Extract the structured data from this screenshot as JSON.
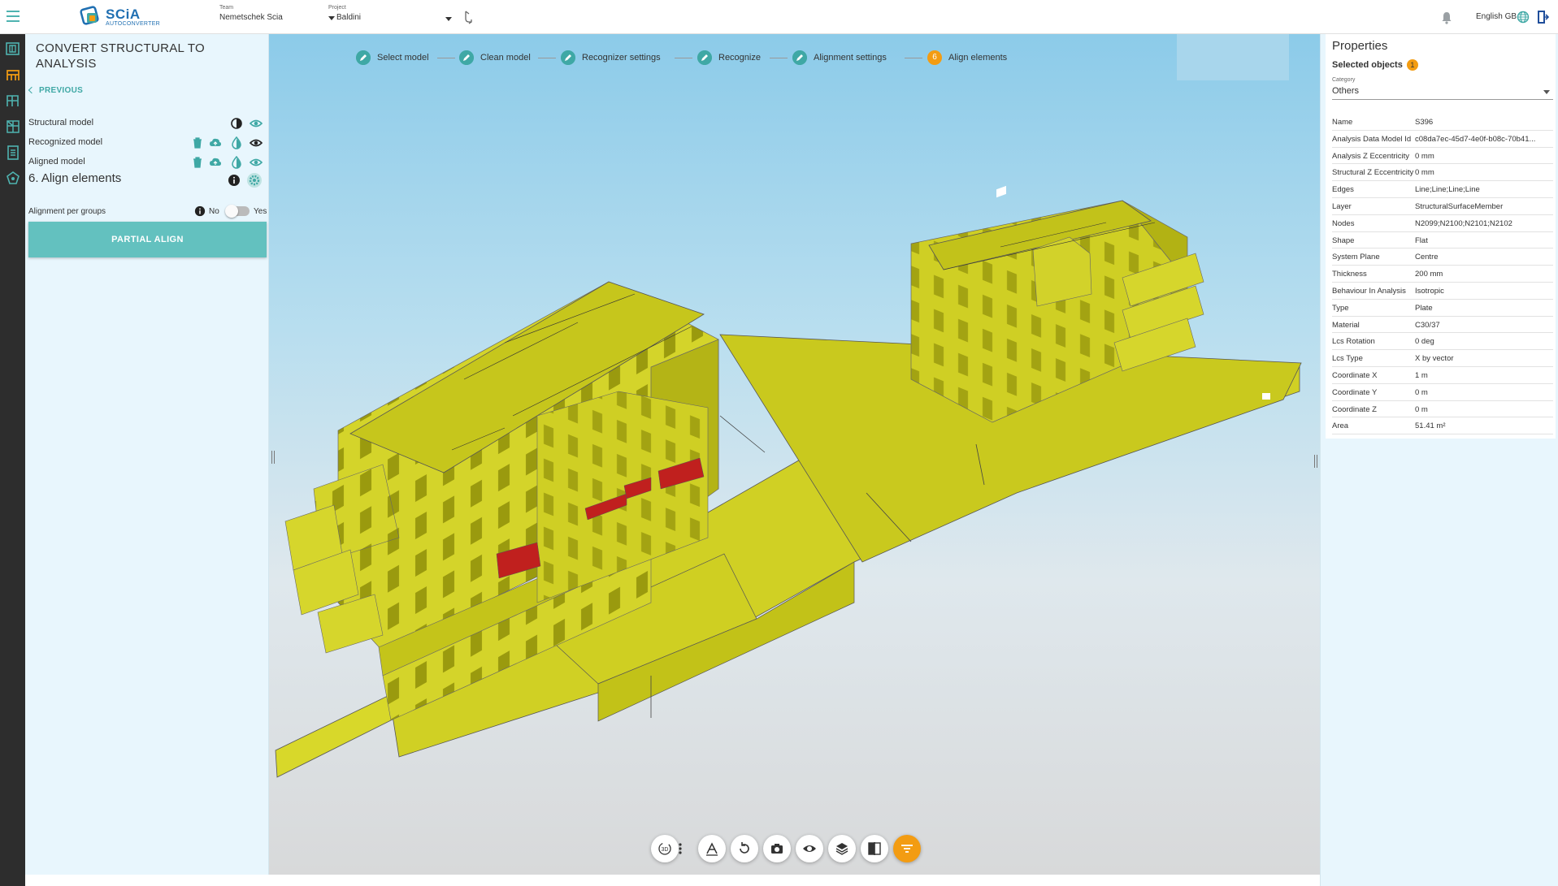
{
  "header": {
    "logo_brand": "SCiA",
    "logo_sub": "AUTOCONVERTER",
    "team_label": "Team",
    "team_value": "Nemetschek Scia",
    "project_label": "Project",
    "project_value": "Baldini",
    "language": "English GB"
  },
  "left_panel": {
    "title": "CONVERT STRUCTURAL TO ANALYSIS",
    "previous": "PREVIOUS",
    "models": [
      {
        "label": "Structural model"
      },
      {
        "label": "Recognized model"
      },
      {
        "label": "Aligned model"
      }
    ],
    "step_title": "6.  Align elements",
    "alignment_label": "Alignment per groups",
    "toggle_no": "No",
    "toggle_yes": "Yes",
    "partial_align": "PARTIAL ALIGN"
  },
  "stepper": {
    "steps": [
      {
        "label": "Select model"
      },
      {
        "label": "Clean model"
      },
      {
        "label": "Recognizer settings"
      },
      {
        "label": "Recognize"
      },
      {
        "label": "Alignment settings"
      },
      {
        "label": "Align elements",
        "number": "6"
      }
    ]
  },
  "toolbar": {
    "view_mode": "3D",
    "icons": [
      "3d-view-icon",
      "more-vert-icon",
      "measure-icon",
      "reset-view-icon",
      "camera-icon",
      "visibility-icon",
      "layers-icon",
      "compare-icon",
      "filter-icon"
    ]
  },
  "properties": {
    "title": "Properties",
    "selected_label": "Selected objects",
    "selected_count": "1",
    "category_label": "Category",
    "category_value": "Others",
    "rows": [
      {
        "k": "Name",
        "v": "S396"
      },
      {
        "k": "Analysis Data Model Id",
        "v": "c08da7ec-45d7-4e0f-b08c-70b41..."
      },
      {
        "k": "Analysis Z Eccentricity",
        "v": "0 mm"
      },
      {
        "k": "Structural Z Eccentricity",
        "v": "0 mm"
      },
      {
        "k": "Edges",
        "v": "Line;Line;Line;Line"
      },
      {
        "k": "Layer",
        "v": "StructuralSurfaceMember"
      },
      {
        "k": "Nodes",
        "v": "N2099;N2100;N2101;N2102"
      },
      {
        "k": "Shape",
        "v": "Flat"
      },
      {
        "k": "System Plane",
        "v": "Centre"
      },
      {
        "k": "Thickness",
        "v": "200 mm"
      },
      {
        "k": "Behaviour In Analysis",
        "v": "Isotropic"
      },
      {
        "k": "Type",
        "v": "Plate"
      },
      {
        "k": "Material",
        "v": "C30/37"
      },
      {
        "k": "Lcs Rotation",
        "v": "0 deg"
      },
      {
        "k": "Lcs Type",
        "v": "X by vector"
      },
      {
        "k": "Coordinate X",
        "v": "1 m"
      },
      {
        "k": "Coordinate Y",
        "v": "0 m"
      },
      {
        "k": "Coordinate Z",
        "v": "0 m"
      },
      {
        "k": "Area",
        "v": "51.41 m²"
      }
    ]
  },
  "colors": {
    "accent": "#3fa8a5",
    "orange": "#f39c12",
    "model_yellow": "#c8c81a",
    "highlight_red": "#c0201e"
  }
}
